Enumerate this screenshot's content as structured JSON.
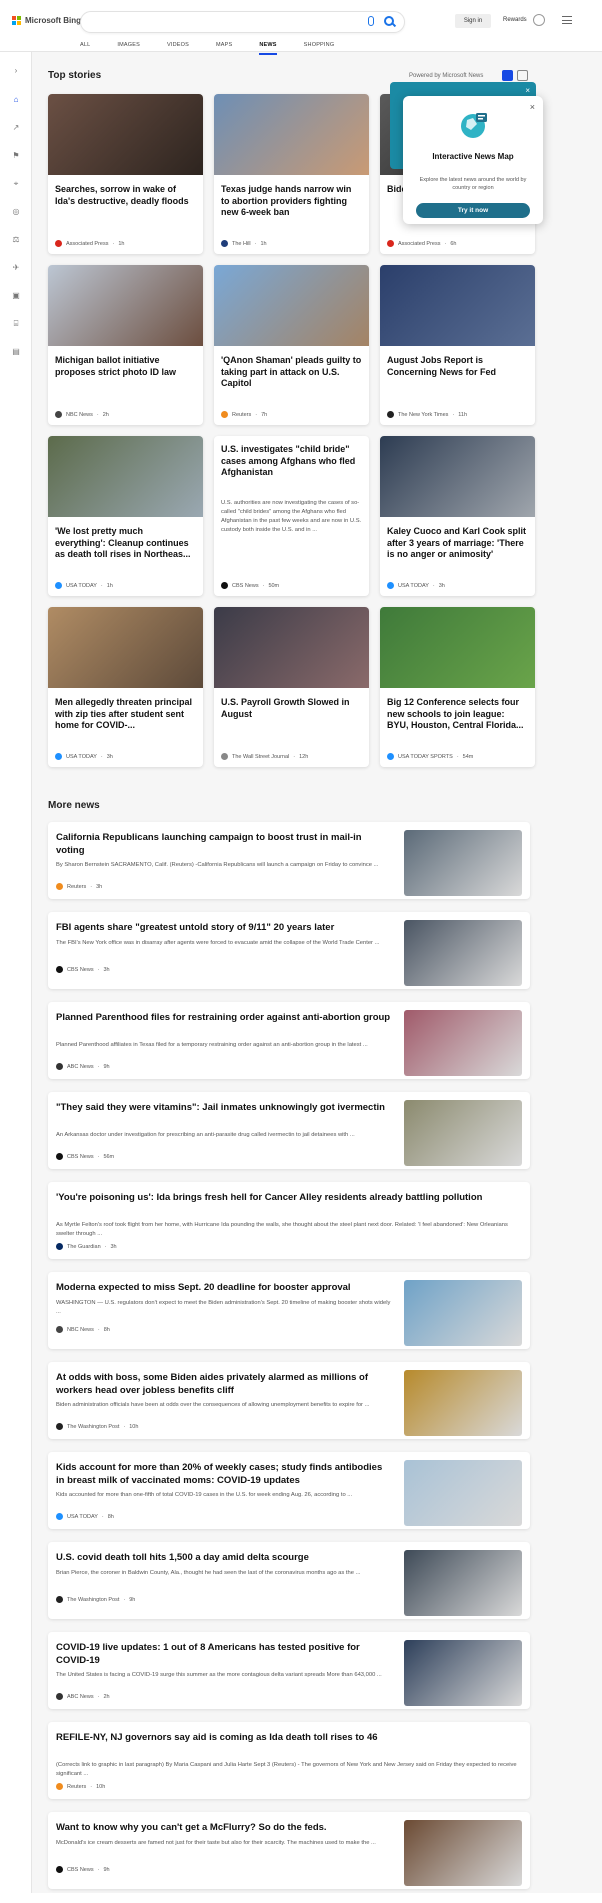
{
  "header": {
    "logo_text": "Microsoft Bing",
    "sign_in": "Sign in",
    "rewards": "Rewards",
    "tabs": [
      "ALL",
      "IMAGES",
      "VIDEOS",
      "MAPS",
      "NEWS",
      "SHOPPING"
    ],
    "active_tab": "NEWS"
  },
  "top_stories": {
    "heading": "Top stories",
    "powered_by": "Powered by Microsoft News",
    "cards": [
      {
        "title": "Searches, sorrow in wake of Ida's destructive, deadly floods",
        "source": "Associated Press",
        "age": "1h",
        "src_color": "#d9261c"
      },
      {
        "title": "Texas judge hands narrow win to abortion providers fighting new 6-week ban",
        "source": "The Hill",
        "age": "1h",
        "src_color": "#1f3d7a"
      },
      {
        "title": "Biden... docu... attac...",
        "source": "Associated Press",
        "age": "6h",
        "src_color": "#d9261c"
      },
      {
        "title": "Michigan ballot initiative proposes strict photo ID law",
        "source": "NBC News",
        "age": "2h",
        "src_color": "#444"
      },
      {
        "title": "'QAnon Shaman' pleads guilty to taking part in attack on U.S. Capitol",
        "source": "Reuters",
        "age": "7h",
        "src_color": "#f08c1e"
      },
      {
        "title": "August Jobs Report is Concerning News for Fed",
        "source": "The New York Times",
        "age": "11h",
        "src_color": "#222"
      },
      {
        "title": "'We lost pretty much everything': Cleanup continues as death toll rises in Northeas...",
        "source": "USA TODAY",
        "age": "1h",
        "src_color": "#1e90ff"
      },
      {
        "title": "U.S. investigates \"child bride\" cases among Afghans who fled Afghanistan",
        "snippet": "U.S. authorities are now investigating the cases of so-called \"child brides\" among the Afghans who fled Afghanistan in the past few weeks and are now in U.S. custody both inside the U.S. and in ...",
        "source": "CBS News",
        "age": "50m",
        "src_color": "#111"
      },
      {
        "title": "Kaley Cuoco and Karl Cook split after 3 years of marriage: 'There is no anger or animosity'",
        "source": "USA TODAY",
        "age": "3h",
        "src_color": "#1e90ff"
      },
      {
        "title": "Men allegedly threaten principal with zip ties after student sent home for COVID-...",
        "source": "USA TODAY",
        "age": "3h",
        "src_color": "#1e90ff"
      },
      {
        "title": "U.S. Payroll Growth Slowed in August",
        "source": "The Wall Street Journal",
        "age": "12h",
        "src_color": "#888"
      },
      {
        "title": "Big 12 Conference selects four new schools to join league: BYU, Houston, Central Florida...",
        "source": "USA TODAY SPORTS",
        "age": "54m",
        "src_color": "#1e90ff"
      }
    ]
  },
  "popup": {
    "title": "Interactive News Map",
    "description": "Explore the latest news around the world by country or region",
    "button": "Try it now",
    "close": "×"
  },
  "more_news": {
    "heading": "More news",
    "items": [
      {
        "title": "California Republicans launching campaign to boost trust in mail-in voting",
        "snippet": "By Sharon Bernstein SACRAMENTO, Calif. (Reuters) -California Republicans will launch a campaign on Friday to convince ...",
        "source": "Reuters",
        "age": "3h",
        "src_color": "#f08c1e",
        "thumb": "#5b6a78"
      },
      {
        "title": "FBI agents share \"greatest untold story of 9/11\" 20 years later",
        "snippet": "The FBI's New York office was in disarray after agents were forced to evacuate amid the collapse of the World Trade Center ...",
        "source": "CBS News",
        "age": "3h",
        "src_color": "#111",
        "thumb": "#4a5563"
      },
      {
        "title": "Planned Parenthood files for restraining order against anti-abortion group",
        "snippet": "Planned Parenthood affiliates in Texas filed for a temporary restraining order against an anti-abortion group in the latest ...",
        "source": "ABC News",
        "age": "9h",
        "src_color": "#333",
        "thumb": "#a05a6a"
      },
      {
        "title": "\"They said they were vitamins\": Jail inmates unknowingly got ivermectin",
        "snippet": "An Arkansas doctor under investigation for prescribing an anti-parasite drug called ivermectin to jail detainees with ...",
        "source": "CBS News",
        "age": "56m",
        "src_color": "#111",
        "thumb": "#8b8a6e"
      },
      {
        "title": "'You're poisoning us': Ida brings fresh hell for Cancer Alley residents already battling pollution",
        "snippet": "As Myrtle Felton's roof took flight from her home, with Hurricane Ida pounding the walls, she thought about the steel plant next door. Related: 'I feel abandoned': New Orleanians swelter through ...",
        "source": "The Guardian",
        "age": "3h",
        "src_color": "#052962",
        "thumb": ""
      },
      {
        "title": "Moderna expected to miss Sept. 20 deadline for booster approval",
        "snippet": "WASHINGTON — U.S. regulators don't expect to meet the Biden administration's Sept. 20 timeline of making booster shots widely ...",
        "source": "NBC News",
        "age": "8h",
        "src_color": "#444",
        "thumb": "#6fa2c7"
      },
      {
        "title": "At odds with boss, some Biden aides privately alarmed as millions of workers head over jobless benefits cliff",
        "snippet": "Biden administration officials have been at odds over the consequences of allowing unemployment benefits to expire for ...",
        "source": "The Washington Post",
        "age": "10h",
        "src_color": "#222",
        "thumb": "#b78a2c"
      },
      {
        "title": "Kids account for more than 20% of weekly cases; study finds antibodies in breast milk of vaccinated moms: COVID-19 updates",
        "snippet": "Kids accounted for more than one-fifth of total COVID-19 cases in the U.S. for week ending Aug. 26, according to ...",
        "source": "USA TODAY",
        "age": "8h",
        "src_color": "#1e90ff",
        "thumb": "#a9c2d6"
      },
      {
        "title": "U.S. covid death toll hits 1,500 a day amid delta scourge",
        "snippet": "Brian Pierce, the coroner in Baldwin County, Ala., thought he had seen the last of the coronavirus months ago as the ...",
        "source": "The Washington Post",
        "age": "9h",
        "src_color": "#222",
        "thumb": "#3e4a57"
      },
      {
        "title": "COVID-19 live updates: 1 out of 8 Americans has tested positive for COVID-19",
        "snippet": "The United States is facing a COVID-19 surge this summer as the more contagious delta variant spreads More than 643,000 ...",
        "source": "ABC News",
        "age": "2h",
        "src_color": "#333",
        "thumb": "#2d3f5a"
      },
      {
        "title": "REFILE-NY, NJ governors say aid is coming as Ida death toll rises to 46",
        "snippet": "(Corrects link to graphic in last paragraph) By Maria Caspani and Julia Harte Sept 3 (Reuters) - The governors of New York and New Jersey said on Friday they expected to receive significant ...",
        "source": "Reuters",
        "age": "10h",
        "src_color": "#f08c1e",
        "thumb": ""
      },
      {
        "title": "Want to know why you can't get a McFlurry? So do the feds.",
        "snippet": "McDonald's ice cream desserts are famed not just for their taste but also for their scarcity. The machines used to make the ...",
        "source": "CBS News",
        "age": "9h",
        "src_color": "#111",
        "thumb": "#6b4a33"
      }
    ]
  },
  "colors": {
    "accent": "#174ae4",
    "map_button": "#1f6f8b"
  }
}
